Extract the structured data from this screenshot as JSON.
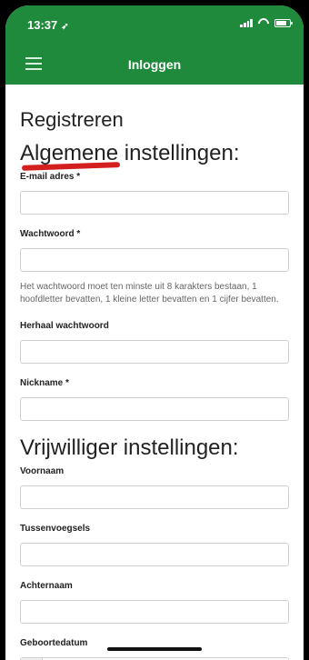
{
  "status": {
    "time": "13:37",
    "location_arrow": "➶"
  },
  "navbar": {
    "title": "Inloggen"
  },
  "page": {
    "title": "Registreren"
  },
  "sections": {
    "general": {
      "title": "Algemene instellingen:",
      "fields": [
        {
          "label": "E-mail adres *",
          "value": ""
        },
        {
          "label": "Wachtwoord *",
          "value": ""
        },
        {
          "label": "Herhaal wachtwoord",
          "value": ""
        },
        {
          "label": "Nickname *",
          "value": ""
        }
      ],
      "password_help": "Het wachtwoord moet ten minste uit 8 karakters bestaan, 1 hoofdletter bevatten, 1 kleine letter bevatten en 1 cijfer bevatten."
    },
    "volunteer": {
      "title": "Vrijwilliger instellingen:",
      "fields": [
        {
          "label": "Voornaam",
          "value": ""
        },
        {
          "label": "Tussenvoegsels",
          "value": ""
        },
        {
          "label": "Achternaam",
          "value": ""
        },
        {
          "label": "Geboortedatum",
          "value": ""
        }
      ]
    }
  },
  "icons": {
    "date_addon": "calendar-icon"
  }
}
